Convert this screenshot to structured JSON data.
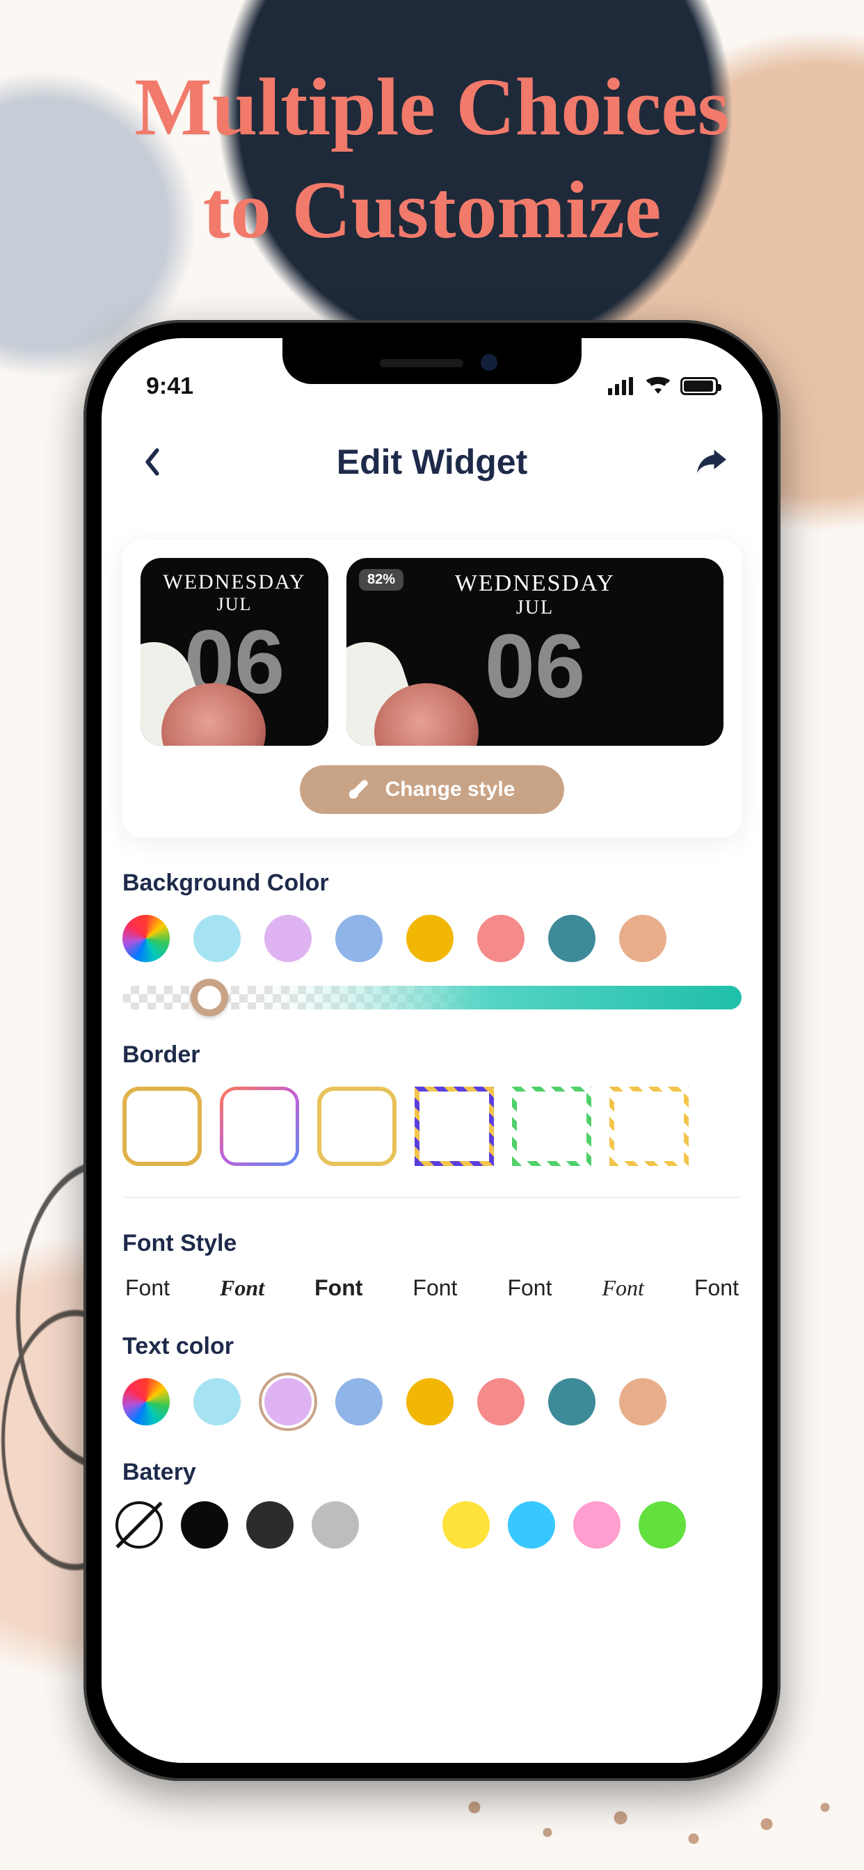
{
  "marketing_heading": "Multiple Choices\nto Customize",
  "status": {
    "time": "9:41"
  },
  "nav": {
    "title": "Edit Widget"
  },
  "preview": {
    "day": "WEDNESDAY",
    "month": "JUL",
    "date": "06",
    "battery_pct": "82%",
    "change_style_label": "Change style"
  },
  "sections": {
    "background": {
      "title": "Background Color",
      "colors": [
        "rainbow",
        "#a6e3f2",
        "#dfb3f2",
        "#8fb4e8",
        "#f2b705",
        "#f58a8a",
        "#3d8a99",
        "#e8ad8b"
      ],
      "slider_value": 14
    },
    "border": {
      "title": "Border",
      "options": [
        "solid-gold",
        "gradient",
        "gold-shine",
        "stripe-purple-gold",
        "stripe-green-white",
        "stripe-yellow-white"
      ]
    },
    "font_style": {
      "title": "Font Style",
      "options": [
        "Font",
        "Font",
        "Font",
        "Font",
        "Font",
        "Font",
        "Font"
      ]
    },
    "text_color": {
      "title": "Text color",
      "colors": [
        "rainbow",
        "#a6e3f2",
        "#dfb3f2",
        "#8fb4e8",
        "#f2b705",
        "#f58a8a",
        "#3d8a99",
        "#e8ad8b"
      ],
      "selected_index": 2
    },
    "battery": {
      "title": "Batery",
      "colors": [
        "none",
        "#0a0a0a",
        "#2c2c2c",
        "#bdbdbd",
        "#ffe23b",
        "#38c7ff",
        "#ff9ecf",
        "#62e03e"
      ]
    }
  }
}
